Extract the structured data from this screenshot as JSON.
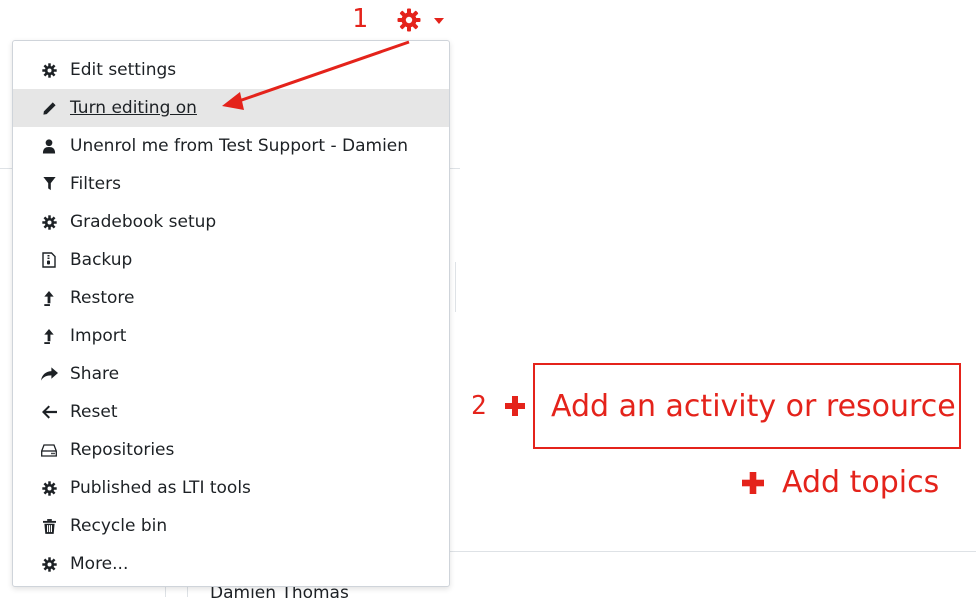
{
  "annotations": {
    "step1": "1",
    "step2": "2"
  },
  "menu": {
    "items": [
      {
        "label": "Edit settings",
        "icon": "gear-icon"
      },
      {
        "label": "Turn editing on",
        "icon": "pencil-icon",
        "active": true
      },
      {
        "label": "Unenrol me from Test Support - Damien",
        "icon": "user-icon"
      },
      {
        "label": "Filters",
        "icon": "filter-icon"
      },
      {
        "label": "Gradebook setup",
        "icon": "gear-icon"
      },
      {
        "label": "Backup",
        "icon": "file-archive-icon"
      },
      {
        "label": "Restore",
        "icon": "upload-icon"
      },
      {
        "label": "Import",
        "icon": "upload-icon"
      },
      {
        "label": "Share",
        "icon": "share-icon"
      },
      {
        "label": "Reset",
        "icon": "arrow-left-icon"
      },
      {
        "label": "Repositories",
        "icon": "hdd-icon"
      },
      {
        "label": "Published as LTI tools",
        "icon": "gear-icon"
      },
      {
        "label": "Recycle bin",
        "icon": "trash-icon"
      },
      {
        "label": "More...",
        "icon": "gear-icon"
      }
    ]
  },
  "actions": {
    "add_activity": "Add an activity or resource",
    "add_topics": "Add topics"
  },
  "background": {
    "user_name": "Damien Thomas"
  },
  "colors": {
    "accent": "#e4231b",
    "active_bg": "#e6e6e6",
    "text": "#1d2125"
  }
}
